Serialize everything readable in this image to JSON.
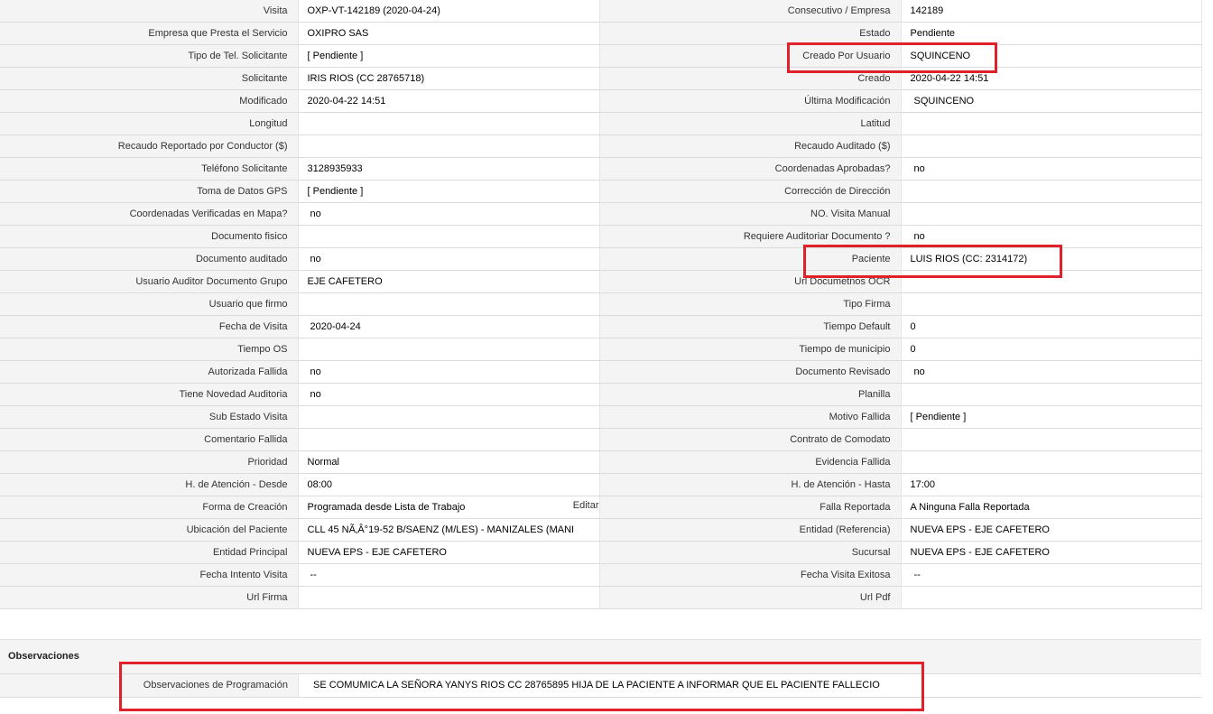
{
  "rows": [
    {
      "l1": "Visita",
      "v1": "OXP-VT-142189 (2020-04-24)",
      "l2": "Consecutivo / Empresa",
      "v2": "142189"
    },
    {
      "l1": "Empresa que Presta el Servicio",
      "v1": "OXIPRO SAS",
      "l2": "Estado",
      "v2": "Pendiente"
    },
    {
      "l1": "Tipo de Tel. Solicitante",
      "v1": "[ Pendiente ]",
      "l2": "Creado Por Usuario",
      "v2": "SQUINCENO"
    },
    {
      "l1": "Solicitante",
      "v1": "IRIS RIOS (CC 28765718)",
      "l2": "Creado",
      "v2": "2020-04-22 14:51"
    },
    {
      "l1": "Modificado",
      "v1": "2020-04-22 14:51",
      "l2": "Última Modificación",
      "v2": "SQUINCENO"
    },
    {
      "l1": "Longitud",
      "v1": "",
      "l2": "Latitud",
      "v2": ""
    },
    {
      "l1": "Recaudo Reportado por Conductor ($)",
      "v1": "",
      "l2": "Recaudo Auditado ($)",
      "v2": ""
    },
    {
      "l1": "Teléfono Solicitante",
      "v1": "3128935933",
      "l2": "Coordenadas Aprobadas?",
      "v2": "no"
    },
    {
      "l1": "Toma de Datos GPS",
      "v1": "[ Pendiente ]",
      "l2": "Corrección de Dirección",
      "v2": ""
    },
    {
      "l1": "Coordenadas Verificadas en Mapa?",
      "v1": "no",
      "l2": "NO. Visita Manual",
      "v2": ""
    },
    {
      "l1": "Documento fisico",
      "v1": "",
      "l2": "Requiere Auditoriar Documento ?",
      "v2": "no"
    },
    {
      "l1": "Documento auditado",
      "v1": "no",
      "l2": "Paciente",
      "v2": "LUIS RIOS (CC: 2314172)"
    },
    {
      "l1": "Usuario Auditor Documento Grupo",
      "v1": "EJE CAFETERO",
      "l2": "Url Documetnos OCR",
      "v2": ""
    },
    {
      "l1": "Usuario que firmo",
      "v1": "",
      "l2": "Tipo Firma",
      "v2": ""
    },
    {
      "l1": "Fecha de Visita",
      "v1": "2020-04-24",
      "l2": "Tiempo Default",
      "v2": "0"
    },
    {
      "l1": "Tiempo OS",
      "v1": "",
      "l2": "Tiempo de municipio",
      "v2": "0"
    },
    {
      "l1": "Autorizada Fallida",
      "v1": "no",
      "l2": "Documento Revisado",
      "v2": "no"
    },
    {
      "l1": "Tiene Novedad Auditoria",
      "v1": "no",
      "l2": "Planilla",
      "v2": ""
    },
    {
      "l1": "Sub Estado Visita",
      "v1": "",
      "l2": "Motivo Fallida",
      "v2": "[ Pendiente ]"
    },
    {
      "l1": "Comentario Fallida",
      "v1": "",
      "l2": "Contrato de Comodato",
      "v2": ""
    },
    {
      "l1": "Prioridad",
      "v1": "Normal",
      "l2": "Evidencia Fallida",
      "v2": ""
    },
    {
      "l1": "H. de Atención - Desde",
      "v1": "08:00",
      "l2": "H. de Atención - Hasta",
      "v2": "17:00"
    },
    {
      "l1": "Forma de Creación",
      "v1": "Programada desde Lista de Trabajo",
      "l2": "Falla Reportada",
      "v2": "A Ninguna Falla Reportada"
    },
    {
      "l1": "Ubicación del Paciente",
      "v1": "CLL 45 NÃ‚Â°19-52 B/SAENZ (M/LES) - MANIZALES (MANI",
      "l2": "Entidad (Referencia)",
      "v2": "NUEVA EPS - EJE CAFETERO"
    },
    {
      "l1": "Entidad Principal",
      "v1": "NUEVA EPS - EJE CAFETERO",
      "l2": "Sucursal",
      "v2": "NUEVA EPS - EJE CAFETERO"
    },
    {
      "l1": "Fecha Intento Visita",
      "v1": "--",
      "l2": "Fecha Visita Exitosa",
      "v2": "--"
    },
    {
      "l1": "Url Firma",
      "v1": "",
      "l2": "Url Pdf",
      "v2": ""
    }
  ],
  "edit_label": "Editar",
  "observaciones": {
    "title": "Observaciones",
    "label": "Observaciones de Programación",
    "value": "SE COMUMICA LA SEÑORA YANYS RIOS CC 28765895 HIJA DE LA PACIENTE A INFORMAR QUE EL PACIENTE FALLECIO"
  },
  "colors": {
    "highlight": "#e0202a",
    "label_bg": "#f4f4f4"
  }
}
